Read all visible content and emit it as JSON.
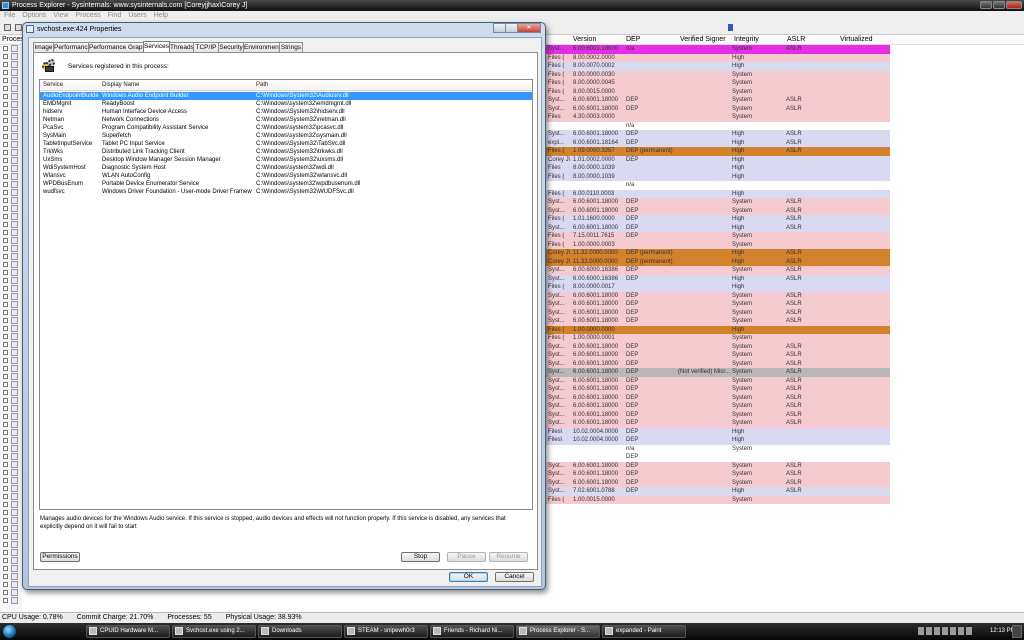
{
  "main_window": {
    "title": "Process Explorer - Sysinternals: www.sysinternals.com [Coreyjjhax\\Corey J]",
    "menu": [
      "File",
      "Options",
      "View",
      "Process",
      "Find",
      "Users",
      "Help"
    ],
    "columns": {
      "process": "Process",
      "version": "Version",
      "dep": "DEP",
      "verified_signer": "Verified Signer",
      "integrity": "Integrity",
      "aslr": "ASLR",
      "virtualized": "Virtualized"
    },
    "rows": [
      {
        "name": "Syst...",
        "version": "6.00.6001.18000",
        "dep": "n/a",
        "signer": "",
        "integrity": "System",
        "aslr": "ASLR",
        "color": "#e62ee6"
      },
      {
        "name": "Files (",
        "version": "8.00.0002.0000",
        "dep": "",
        "signer": "",
        "integrity": "High",
        "aslr": "",
        "color": "#f5cbd0"
      },
      {
        "name": "Files (",
        "version": "8.00.0070.0002",
        "dep": "",
        "signer": "",
        "integrity": "High",
        "aslr": "",
        "color": "#d9d9f2"
      },
      {
        "name": "Files (",
        "version": "8.00.0000.0030",
        "dep": "",
        "signer": "",
        "integrity": "System",
        "aslr": "",
        "color": "#f5cbd0"
      },
      {
        "name": "Files (",
        "version": "8.00.0000.0045",
        "dep": "",
        "signer": "",
        "integrity": "System",
        "aslr": "",
        "color": "#f5cbd0"
      },
      {
        "name": "Files (",
        "version": "8.00.0015.0000",
        "dep": "",
        "signer": "",
        "integrity": "System",
        "aslr": "",
        "color": "#f5cbd0"
      },
      {
        "name": "Syst...",
        "version": "6.00.6001.18000",
        "dep": "DEP",
        "signer": "",
        "integrity": "System",
        "aslr": "ASLR",
        "color": "#f5cbd0"
      },
      {
        "name": "Syst...",
        "version": "6.00.6001.18000",
        "dep": "DEP",
        "signer": "",
        "integrity": "System",
        "aslr": "ASLR",
        "color": "#f5cbd0"
      },
      {
        "name": "Files",
        "version": "4.30.0003.0000",
        "dep": "",
        "signer": "",
        "integrity": "System",
        "aslr": "",
        "color": "#f5cbd0"
      },
      {
        "name": "",
        "version": "",
        "dep": "n/a",
        "signer": "",
        "integrity": "",
        "aslr": "",
        "color": "#ffffff"
      },
      {
        "name": "Syst...",
        "version": "6.00.6001.18000",
        "dep": "DEP",
        "signer": "",
        "integrity": "High",
        "aslr": "ASLR",
        "color": "#d9d9f2"
      },
      {
        "name": "expl...",
        "version": "6.00.6001.18164",
        "dep": "DEP",
        "signer": "",
        "integrity": "High",
        "aslr": "ASLR",
        "color": "#d9d9f2"
      },
      {
        "name": "Files (",
        "version": "1.09.0000.3257",
        "dep": "DEP (permanent)",
        "signer": "",
        "integrity": "High",
        "aslr": "ASLR",
        "color": "#d2822c"
      },
      {
        "name": "Corey J\\",
        "version": "1.01.0002.0000",
        "dep": "DEP",
        "signer": "",
        "integrity": "High",
        "aslr": "",
        "color": "#d9d9f2"
      },
      {
        "name": "Files",
        "version": "8.00.0000.1039",
        "dep": "",
        "signer": "",
        "integrity": "High",
        "aslr": "",
        "color": "#d9d9f2"
      },
      {
        "name": "Files (",
        "version": "8.00.0000.1039",
        "dep": "",
        "signer": "",
        "integrity": "High",
        "aslr": "",
        "color": "#d9d9f2"
      },
      {
        "name": "",
        "version": "",
        "dep": "n/a",
        "signer": "",
        "integrity": "",
        "aslr": "",
        "color": "#ffffff"
      },
      {
        "name": "Files (",
        "version": "6.00.0110.0003",
        "dep": "",
        "signer": "",
        "integrity": "High",
        "aslr": "",
        "color": "#d9d9f2"
      },
      {
        "name": "Syst...",
        "version": "6.00.6001.18000",
        "dep": "DEP",
        "signer": "",
        "integrity": "System",
        "aslr": "ASLR",
        "color": "#f5cbd0"
      },
      {
        "name": "Syst...",
        "version": "6.00.6001.18000",
        "dep": "DEP",
        "signer": "",
        "integrity": "System",
        "aslr": "ASLR",
        "color": "#f5cbd0"
      },
      {
        "name": "Files (",
        "version": "1.01.1600.0000",
        "dep": "DEP",
        "signer": "",
        "integrity": "High",
        "aslr": "ASLR",
        "color": "#d9d9f2"
      },
      {
        "name": "Syst...",
        "version": "6.00.6001.18000",
        "dep": "DEP",
        "signer": "",
        "integrity": "High",
        "aslr": "ASLR",
        "color": "#d9d9f2"
      },
      {
        "name": "Files (",
        "version": "7.15.0011.7615",
        "dep": "DEP",
        "signer": "",
        "integrity": "System",
        "aslr": "",
        "color": "#f5cbd0"
      },
      {
        "name": "Files (",
        "version": "1.00.0000.0003",
        "dep": "",
        "signer": "",
        "integrity": "System",
        "aslr": "",
        "color": "#f5cbd0"
      },
      {
        "name": "Corey J\\",
        "version": "11.32.0000.0000",
        "dep": "DEP (permanent)",
        "signer": "",
        "integrity": "High",
        "aslr": "ASLR",
        "color": "#d2822c"
      },
      {
        "name": "Corey J\\",
        "version": "11.32.0000.0000",
        "dep": "DEP (permanent)",
        "signer": "",
        "integrity": "High",
        "aslr": "ASLR",
        "color": "#d2822c"
      },
      {
        "name": "Syst...",
        "version": "6.00.6000.16386",
        "dep": "DEP",
        "signer": "",
        "integrity": "System",
        "aslr": "ASLR",
        "color": "#f5cbd0"
      },
      {
        "name": "Syst...",
        "version": "6.00.6000.16386",
        "dep": "DEP",
        "signer": "",
        "integrity": "High",
        "aslr": "ASLR",
        "color": "#d9d9f2"
      },
      {
        "name": "Files (",
        "version": "8.00.0000.0017",
        "dep": "",
        "signer": "",
        "integrity": "High",
        "aslr": "",
        "color": "#d9d9f2"
      },
      {
        "name": "Syst...",
        "version": "6.00.6001.18000",
        "dep": "DEP",
        "signer": "",
        "integrity": "System",
        "aslr": "ASLR",
        "color": "#f5cbd0"
      },
      {
        "name": "Syst...",
        "version": "6.00.6001.18000",
        "dep": "DEP",
        "signer": "",
        "integrity": "System",
        "aslr": "ASLR",
        "color": "#f5cbd0"
      },
      {
        "name": "Syst...",
        "version": "6.00.6001.18000",
        "dep": "DEP",
        "signer": "",
        "integrity": "System",
        "aslr": "ASLR",
        "color": "#f5cbd0"
      },
      {
        "name": "Syst...",
        "version": "6.00.6001.18000",
        "dep": "DEP",
        "signer": "",
        "integrity": "System",
        "aslr": "ASLR",
        "color": "#f5cbd0"
      },
      {
        "name": "Files (",
        "version": "1.00.0000.0000",
        "dep": "",
        "signer": "",
        "integrity": "High",
        "aslr": "",
        "color": "#d2822c"
      },
      {
        "name": "Files (",
        "version": "1.00.0000.0001",
        "dep": "",
        "signer": "",
        "integrity": "System",
        "aslr": "",
        "color": "#f5cbd0"
      },
      {
        "name": "Syst...",
        "version": "6.00.6001.18000",
        "dep": "DEP",
        "signer": "",
        "integrity": "System",
        "aslr": "ASLR",
        "color": "#f5cbd0"
      },
      {
        "name": "Syst...",
        "version": "6.00.6001.18000",
        "dep": "DEP",
        "signer": "",
        "integrity": "System",
        "aslr": "ASLR",
        "color": "#f5cbd0"
      },
      {
        "name": "Syst...",
        "version": "6.00.6001.18000",
        "dep": "DEP",
        "signer": "",
        "integrity": "System",
        "aslr": "ASLR",
        "color": "#f5cbd0"
      },
      {
        "name": "Syst...",
        "version": "6.00.6001.18000",
        "dep": "DEP",
        "signer": "(Not verified) Micr...",
        "integrity": "System",
        "aslr": "ASLR",
        "color": "#b8b8b8"
      },
      {
        "name": "Syst...",
        "version": "6.00.6001.18000",
        "dep": "DEP",
        "signer": "",
        "integrity": "System",
        "aslr": "ASLR",
        "color": "#f5cbd0"
      },
      {
        "name": "Syst...",
        "version": "6.00.6001.18000",
        "dep": "DEP",
        "signer": "",
        "integrity": "System",
        "aslr": "ASLR",
        "color": "#f5cbd0"
      },
      {
        "name": "Syst...",
        "version": "6.00.6001.18000",
        "dep": "DEP",
        "signer": "",
        "integrity": "System",
        "aslr": "ASLR",
        "color": "#f5cbd0"
      },
      {
        "name": "Syst...",
        "version": "6.00.6001.18000",
        "dep": "DEP",
        "signer": "",
        "integrity": "System",
        "aslr": "ASLR",
        "color": "#f5cbd0"
      },
      {
        "name": "Syst...",
        "version": "6.00.6001.18000",
        "dep": "DEP",
        "signer": "",
        "integrity": "System",
        "aslr": "ASLR",
        "color": "#f5cbd0"
      },
      {
        "name": "Syst...",
        "version": "6.00.6001.18000",
        "dep": "DEP",
        "signer": "",
        "integrity": "System",
        "aslr": "ASLR",
        "color": "#f5cbd0"
      },
      {
        "name": "Files\\",
        "version": "10.02.0004.0000",
        "dep": "DEP",
        "signer": "",
        "integrity": "High",
        "aslr": "",
        "color": "#d9d9f2"
      },
      {
        "name": "Files\\",
        "version": "10.02.0004.0000",
        "dep": "DEP",
        "signer": "",
        "integrity": "High",
        "aslr": "",
        "color": "#d9d9f2"
      },
      {
        "name": "",
        "version": "",
        "dep": "n/a",
        "signer": "",
        "integrity": "System",
        "aslr": "",
        "color": "#ffffff"
      },
      {
        "name": "",
        "version": "",
        "dep": "DEP",
        "signer": "",
        "integrity": "",
        "aslr": "",
        "color": "#ffffff"
      },
      {
        "name": "Syst...",
        "version": "6.00.6001.18000",
        "dep": "DEP",
        "signer": "",
        "integrity": "System",
        "aslr": "ASLR",
        "color": "#f5cbd0"
      },
      {
        "name": "Syst...",
        "version": "6.00.6001.18000",
        "dep": "DEP",
        "signer": "",
        "integrity": "System",
        "aslr": "ASLR",
        "color": "#f5cbd0"
      },
      {
        "name": "Syst...",
        "version": "6.00.6001.18000",
        "dep": "DEP",
        "signer": "",
        "integrity": "System",
        "aslr": "ASLR",
        "color": "#f5cbd0"
      },
      {
        "name": "Syst...",
        "version": "7.02.6001.0788",
        "dep": "DEP",
        "signer": "",
        "integrity": "High",
        "aslr": "ASLR",
        "color": "#d9d9f2"
      },
      {
        "name": "Files (",
        "version": "1.00.0015.0000",
        "dep": "",
        "signer": "",
        "integrity": "System",
        "aslr": "",
        "color": "#f5cbd0"
      }
    ],
    "status": {
      "cpu_usage": "CPU Usage: 0.78%",
      "commit_charge": "Commit Charge: 21.70%",
      "processes": "Processes: 55",
      "physical_usage": "Physical Usage: 38.93%"
    }
  },
  "dialog": {
    "title": "svchost.exe:424 Properties",
    "tabs": [
      "Image",
      "Performance",
      "Performance Graph",
      "Services",
      "Threads",
      "TCP/IP",
      "Security",
      "Environment",
      "Strings"
    ],
    "selected_tab": "Services",
    "intro": "Services registered in this process:",
    "list_headers": {
      "service": "Service",
      "display_name": "Display Name",
      "path": "Path"
    },
    "services": [
      {
        "service": "AudioEndpointBuilder",
        "display": "Windows Audio Endpoint Builder",
        "path": "C:\\Windows\\System32\\Audiosrv.dll",
        "selected": true
      },
      {
        "service": "EMDMgmt",
        "display": "ReadyBoost",
        "path": "C:\\Windows\\system32\\emdmgmt.dll"
      },
      {
        "service": "hidserv",
        "display": "Human Interface Device Access",
        "path": "C:\\Windows\\System32\\hidserv.dll"
      },
      {
        "service": "Netman",
        "display": "Network Connections",
        "path": "C:\\Windows\\System32\\netman.dll"
      },
      {
        "service": "PcaSvc",
        "display": "Program Compatibility Assistant Service",
        "path": "C:\\Windows\\system32\\pcasvc.dll"
      },
      {
        "service": "SysMain",
        "display": "Superfetch",
        "path": "C:\\Windows\\system32\\sysmain.dll"
      },
      {
        "service": "TabletInputService",
        "display": "Tablet PC Input Service",
        "path": "C:\\Windows\\System32\\TabSvc.dll"
      },
      {
        "service": "TrkWks",
        "display": "Distributed Link Tracking Client",
        "path": "C:\\Windows\\System32\\trkwks.dll"
      },
      {
        "service": "UxSms",
        "display": "Desktop Window Manager Session Manager",
        "path": "C:\\Windows\\System32\\uxsms.dll"
      },
      {
        "service": "WdiSystemHost",
        "display": "Diagnostic System Host",
        "path": "C:\\Windows\\system32\\wdi.dll"
      },
      {
        "service": "Wlansvc",
        "display": "WLAN AutoConfig",
        "path": "C:\\Windows\\System32\\wlansvc.dll"
      },
      {
        "service": "WPDBusEnum",
        "display": "Portable Device Enumerator Service",
        "path": "C:\\Windows\\system32\\wpdbusenum.dll"
      },
      {
        "service": "wudfsvc",
        "display": "Windows Driver Foundation - User-mode Driver Framework",
        "path": "C:\\Windows\\System32\\WUDFSvc.dll"
      }
    ],
    "description": "Manages audio devices for the Windows Audio service.  If this service is stopped, audio devices and effects will not function properly.  If this service is disabled, any services that explicitly depend on it will fail to start",
    "buttons": {
      "permissions": "Permissions",
      "stop": "Stop",
      "pause": "Pause",
      "resume": "Resume",
      "ok": "OK",
      "cancel": "Cancel"
    }
  },
  "taskbar": {
    "items": [
      "CPUID Hardware M...",
      "Svchost.exe using 2...",
      "Downloads",
      "STEAM - snipewh0r3",
      "Friends - Richard Ni...",
      "Process Explorer - S...",
      "expanded - Paint"
    ],
    "active_item": "Process Explorer - S...",
    "clock": "12:13 PM"
  }
}
